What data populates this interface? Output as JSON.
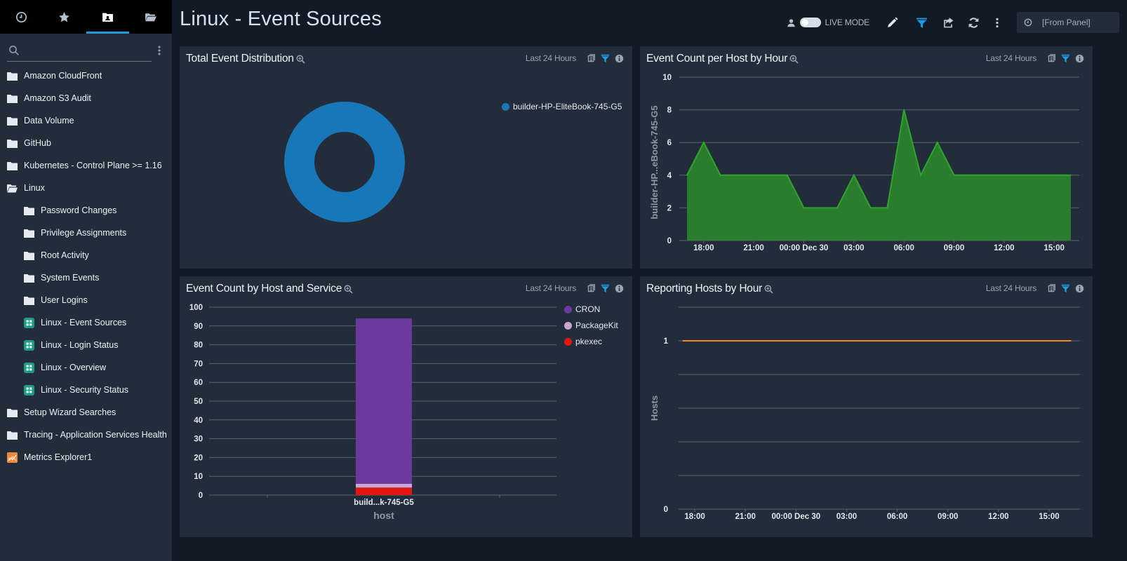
{
  "sidebar": {
    "tabs": [
      {
        "name": "recent",
        "icon": "clock-icon"
      },
      {
        "name": "favorites",
        "icon": "star-icon"
      },
      {
        "name": "personal",
        "icon": "personal-folder-icon",
        "active": true
      },
      {
        "name": "library",
        "icon": "folder-open-icon"
      }
    ],
    "search": {
      "placeholder": "",
      "value": ""
    },
    "items": [
      {
        "label": "Amazon CloudFront",
        "type": "folder",
        "level": 0
      },
      {
        "label": "Amazon S3 Audit",
        "type": "folder",
        "level": 0
      },
      {
        "label": "Data Volume",
        "type": "folder",
        "level": 0
      },
      {
        "label": "GitHub",
        "type": "folder",
        "level": 0
      },
      {
        "label": "Kubernetes - Control Plane >= 1.16",
        "type": "folder",
        "level": 0
      },
      {
        "label": "Linux",
        "type": "folder-open",
        "level": 0
      },
      {
        "label": "Password Changes",
        "type": "folder",
        "level": 1
      },
      {
        "label": "Privilege Assignments",
        "type": "folder",
        "level": 1
      },
      {
        "label": "Root Activity",
        "type": "folder",
        "level": 1
      },
      {
        "label": "System Events",
        "type": "folder",
        "level": 1
      },
      {
        "label": "User Logins",
        "type": "folder",
        "level": 1
      },
      {
        "label": "Linux - Event Sources",
        "type": "dashboard",
        "level": 1
      },
      {
        "label": "Linux - Login Status",
        "type": "dashboard",
        "level": 1
      },
      {
        "label": "Linux - Overview",
        "type": "dashboard",
        "level": 1
      },
      {
        "label": "Linux - Security Status",
        "type": "dashboard",
        "level": 1
      },
      {
        "label": "Setup Wizard Searches",
        "type": "folder",
        "level": 0
      },
      {
        "label": "Tracing - Application Services Health",
        "type": "folder",
        "level": 0
      },
      {
        "label": "Metrics Explorer1",
        "type": "metrics",
        "level": 0
      }
    ]
  },
  "header": {
    "title": "Linux - Event Sources",
    "live_mode_label": "LIVE MODE",
    "live_mode_on": false,
    "time_range": "[From Panel]"
  },
  "colors": {
    "accent": "#1e9be0",
    "donut": "#1777b8",
    "area_fill": "#2a7d2c",
    "area_line": "#2fa52f",
    "cron": "#6b3a9e",
    "packagekit": "#c7a8d4",
    "pkexec": "#e2170f",
    "hosts_line": "#f08a2c"
  },
  "panels": [
    {
      "title": "Total Event Distribution",
      "range": "Last 24 Hours"
    },
    {
      "title": "Event Count per Host by Hour",
      "range": "Last 24 Hours"
    },
    {
      "title": "Event Count by Host and Service",
      "range": "Last 24 Hours"
    },
    {
      "title": "Reporting Hosts by Hour",
      "range": "Last 24 Hours"
    }
  ],
  "chart_data": [
    {
      "type": "pie",
      "variant": "donut",
      "title": "Total Event Distribution",
      "categories": [
        "builder-HP-EliteBook-745-G5"
      ],
      "values": [
        100
      ],
      "legend": "top-right"
    },
    {
      "type": "area",
      "title": "Event Count per Host by Hour",
      "x": [
        "17:00",
        "18:00",
        "19:00",
        "20:00",
        "21:00",
        "22:00",
        "23:00",
        "00:00",
        "01:00",
        "02:00",
        "03:00",
        "04:00",
        "05:00",
        "06:00",
        "07:00",
        "08:00",
        "09:00",
        "10:00",
        "11:00",
        "12:00",
        "13:00",
        "14:00",
        "15:00",
        "16:00"
      ],
      "x_tick_labels": [
        "18:00",
        "21:00",
        "00:00 Dec 30",
        "03:00",
        "06:00",
        "09:00",
        "12:00",
        "15:00"
      ],
      "series": [
        {
          "name": "builder-HP-EliteBook-745-G5",
          "values": [
            4,
            6,
            4,
            4,
            4,
            4,
            4,
            2,
            2,
            2,
            4,
            2,
            2,
            8,
            4,
            6,
            4,
            4,
            4,
            4,
            4,
            4,
            4,
            4
          ]
        }
      ],
      "ylabel": "builder-HP...eBook-745-G5",
      "yticks": [
        0,
        2,
        4,
        6,
        8,
        10
      ],
      "ylim": [
        0,
        10
      ],
      "grid": true
    },
    {
      "type": "bar",
      "stacked": true,
      "title": "Event Count by Host and Service",
      "categories": [
        "build...k-745-G5"
      ],
      "xlabel": "host",
      "series": [
        {
          "name": "pkexec",
          "values": [
            4
          ]
        },
        {
          "name": "PackageKit",
          "values": [
            2
          ]
        },
        {
          "name": "CRON",
          "values": [
            88
          ]
        }
      ],
      "legend_order": [
        "CRON",
        "PackageKit",
        "pkexec"
      ],
      "yticks": [
        0,
        10,
        20,
        30,
        40,
        50,
        60,
        70,
        80,
        90,
        100
      ],
      "ylim": [
        0,
        100
      ],
      "grid": true,
      "legend": "right"
    },
    {
      "type": "line",
      "title": "Reporting Hosts by Hour",
      "x": [
        "17:00",
        "18:00",
        "19:00",
        "20:00",
        "21:00",
        "22:00",
        "23:00",
        "00:00",
        "01:00",
        "02:00",
        "03:00",
        "04:00",
        "05:00",
        "06:00",
        "07:00",
        "08:00",
        "09:00",
        "10:00",
        "11:00",
        "12:00",
        "13:00",
        "14:00",
        "15:00",
        "16:00"
      ],
      "x_tick_labels": [
        "18:00",
        "21:00",
        "00:00 Dec 30",
        "03:00",
        "06:00",
        "09:00",
        "12:00",
        "15:00"
      ],
      "series": [
        {
          "name": "Hosts",
          "values": [
            1,
            1,
            1,
            1,
            1,
            1,
            1,
            1,
            1,
            1,
            1,
            1,
            1,
            1,
            1,
            1,
            1,
            1,
            1,
            1,
            1,
            1,
            1,
            1
          ]
        }
      ],
      "ylabel": "Hosts",
      "yticks": [
        0,
        1
      ],
      "ylim": [
        0,
        1.2
      ],
      "grid": true
    }
  ]
}
